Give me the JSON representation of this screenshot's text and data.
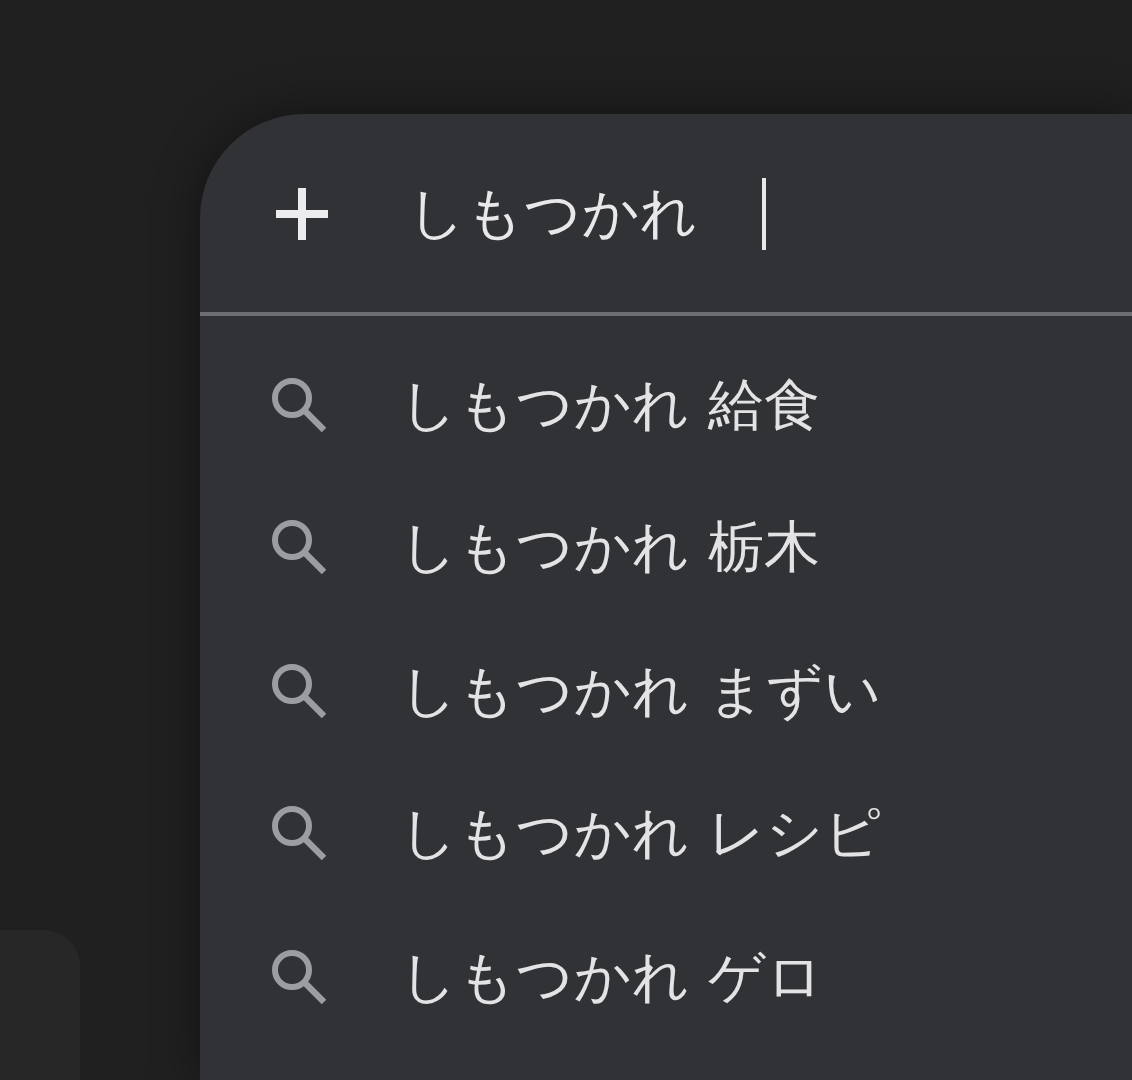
{
  "omnibox": {
    "query": "しもつかれ"
  },
  "suggestions": [
    {
      "text": "しもつかれ 給食"
    },
    {
      "text": "しもつかれ 栃木"
    },
    {
      "text": "しもつかれ まずい"
    },
    {
      "text": "しもつかれ レシピ"
    },
    {
      "text": "しもつかれ ゲロ"
    }
  ]
}
